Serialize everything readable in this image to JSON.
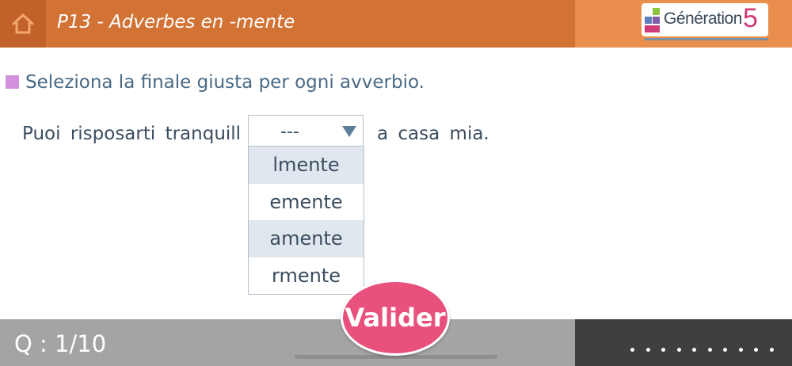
{
  "header": {
    "title": "P13 - Adverbes en -mente",
    "home_icon": "home-icon",
    "colors": {
      "bar": "#d27335",
      "home": "#c2622b",
      "right": "#e98e4d"
    }
  },
  "logo": {
    "text": "Génération",
    "number": "5"
  },
  "instruction": {
    "text": "Seleziona la finale giusta per ogni avverbio."
  },
  "sentence": {
    "before": "Puoi risposarti tranquill",
    "after": "a casa mia."
  },
  "select": {
    "selected": "---",
    "options": [
      "lmente",
      "emente",
      "amente",
      "rmente"
    ]
  },
  "footer": {
    "question_counter": "Q : 1/10",
    "progress_dots": 10
  },
  "valider_label": "Valider"
}
